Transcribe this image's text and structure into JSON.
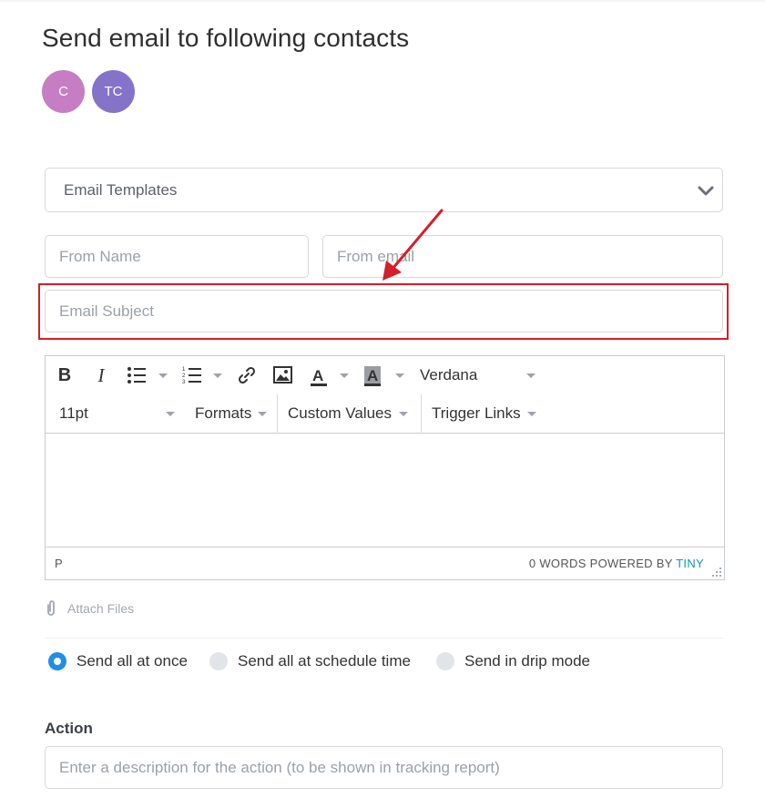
{
  "header": {
    "title": "Send email to following contacts"
  },
  "contacts": [
    {
      "initials": "C",
      "color": "#c67dc3"
    },
    {
      "initials": "TC",
      "color": "#8573c9"
    }
  ],
  "form": {
    "templates_value": "Email Templates",
    "from_name_placeholder": "From Name",
    "from_email_placeholder": "From email",
    "subject_placeholder": "Email Subject",
    "action_label": "Action",
    "action_placeholder": "Enter a description for the action (to be shown in tracking report)"
  },
  "editor": {
    "font_family": "Verdana",
    "font_size": "11pt",
    "formats_label": "Formats",
    "custom_values_label": "Custom Values",
    "trigger_links_label": "Trigger Links",
    "status_path": "P",
    "word_count_text": "0 WORDS POWERED BY",
    "brand": "TINY"
  },
  "attachments": {
    "label": "Attach Files"
  },
  "send_mode": {
    "options": [
      "Send all at once",
      "Send all at schedule time",
      "Send in drip mode"
    ],
    "selected": "Send all at once"
  },
  "annotation": {
    "highlight_color": "#d3202a",
    "target": "Email Subject"
  },
  "colors": {
    "accent": "#1f8fe5",
    "border": "#d4d7dc",
    "tiny_brand": "#1a8fd1"
  }
}
